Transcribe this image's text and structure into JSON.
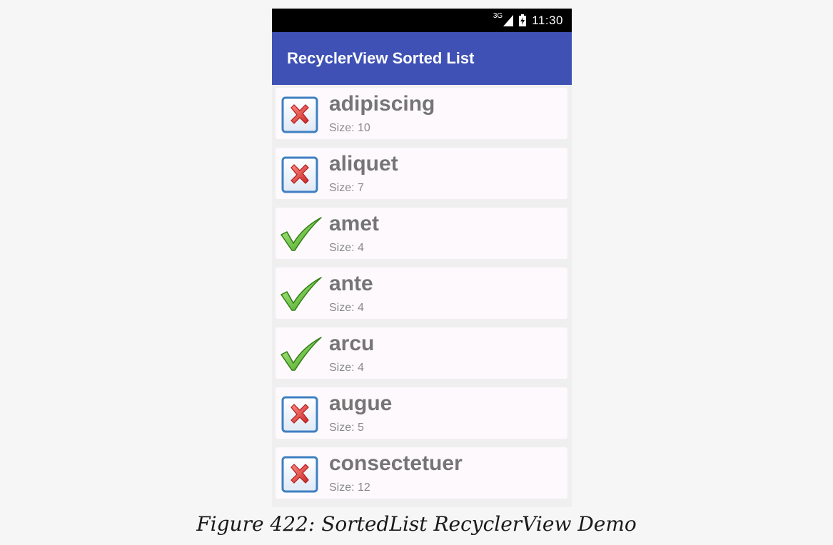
{
  "status_bar": {
    "network": "3G",
    "time": "11:30"
  },
  "app_bar": {
    "title": "RecyclerView Sorted List"
  },
  "items": [
    {
      "word": "adipiscing",
      "size": "Size: 10",
      "icon": "red-x-icon"
    },
    {
      "word": "aliquet",
      "size": "Size: 7",
      "icon": "red-x-icon"
    },
    {
      "word": "amet",
      "size": "Size: 4",
      "icon": "green-check-icon"
    },
    {
      "word": "ante",
      "size": "Size: 4",
      "icon": "green-check-icon"
    },
    {
      "word": "arcu",
      "size": "Size: 4",
      "icon": "green-check-icon"
    },
    {
      "word": "augue",
      "size": "Size: 5",
      "icon": "red-x-icon"
    },
    {
      "word": "consectetuer",
      "size": "Size: 12",
      "icon": "red-x-icon"
    }
  ],
  "caption": "Figure 422: SortedList RecyclerView Demo",
  "colors": {
    "app_bar": "#3f51b5",
    "status_bar": "#000000",
    "item_text": "#757575",
    "cross_red": "#e53935",
    "check_green": "#6dd13e"
  }
}
